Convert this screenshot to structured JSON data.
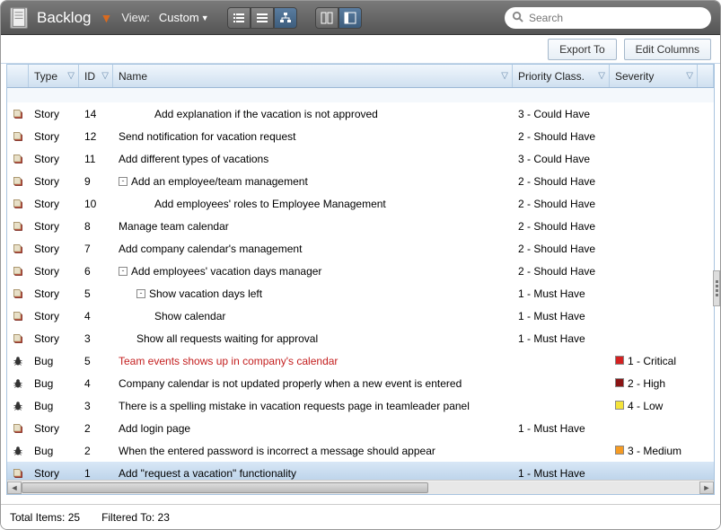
{
  "header": {
    "title": "Backlog",
    "view_label": "View:",
    "view_value": "Custom",
    "search_placeholder": "Search"
  },
  "toolbar": {
    "export_label": "Export To",
    "edit_columns_label": "Edit Columns"
  },
  "columns": {
    "type": "Type",
    "id": "ID",
    "name": "Name",
    "priority": "Priority Class.",
    "severity": "Severity"
  },
  "rows": [
    {
      "kind": "story",
      "type": "Story",
      "id": "14",
      "name": "Add explanation if the vacation is not approved",
      "indent": 2,
      "exp": "",
      "prio": "3 - Could Have",
      "sev": "",
      "sevColor": ""
    },
    {
      "kind": "story",
      "type": "Story",
      "id": "12",
      "name": "Send notification for vacation request",
      "indent": 0,
      "exp": "",
      "prio": "2 - Should Have",
      "sev": "",
      "sevColor": ""
    },
    {
      "kind": "story",
      "type": "Story",
      "id": "11",
      "name": "Add different types of vacations",
      "indent": 0,
      "exp": "",
      "prio": "3 - Could Have",
      "sev": "",
      "sevColor": ""
    },
    {
      "kind": "story",
      "type": "Story",
      "id": "9",
      "name": "Add an employee/team management",
      "indent": 0,
      "exp": "-",
      "prio": "2 - Should Have",
      "sev": "",
      "sevColor": ""
    },
    {
      "kind": "story",
      "type": "Story",
      "id": "10",
      "name": "Add employees' roles to Employee Management",
      "indent": 2,
      "exp": "",
      "prio": "2 - Should Have",
      "sev": "",
      "sevColor": ""
    },
    {
      "kind": "story",
      "type": "Story",
      "id": "8",
      "name": "Manage team calendar",
      "indent": 0,
      "exp": "",
      "prio": "2 - Should Have",
      "sev": "",
      "sevColor": ""
    },
    {
      "kind": "story",
      "type": "Story",
      "id": "7",
      "name": "Add company calendar's management",
      "indent": 0,
      "exp": "",
      "prio": "2 - Should Have",
      "sev": "",
      "sevColor": ""
    },
    {
      "kind": "story",
      "type": "Story",
      "id": "6",
      "name": "Add employees' vacation days manager",
      "indent": 0,
      "exp": "-",
      "prio": "2 - Should Have",
      "sev": "",
      "sevColor": ""
    },
    {
      "kind": "story",
      "type": "Story",
      "id": "5",
      "name": "Show vacation days left",
      "indent": 1,
      "exp": "-",
      "prio": "1 - Must Have",
      "sev": "",
      "sevColor": ""
    },
    {
      "kind": "story",
      "type": "Story",
      "id": "4",
      "name": "Show calendar",
      "indent": 2,
      "exp": "",
      "prio": "1 - Must Have",
      "sev": "",
      "sevColor": ""
    },
    {
      "kind": "story",
      "type": "Story",
      "id": "3",
      "name": "Show all requests waiting for approval",
      "indent": 1,
      "exp": "",
      "prio": "1 - Must Have",
      "sev": "",
      "sevColor": ""
    },
    {
      "kind": "bug",
      "type": "Bug",
      "id": "5",
      "name": "Team events shows up in company's calendar",
      "indent": 0,
      "exp": "",
      "prio": "",
      "sev": "1 - Critical",
      "sevColor": "#d32121",
      "red": true
    },
    {
      "kind": "bug",
      "type": "Bug",
      "id": "4",
      "name": "Company calendar is not updated properly when a new event is entered",
      "indent": 0,
      "exp": "",
      "prio": "",
      "sev": "2 - High",
      "sevColor": "#8a1414"
    },
    {
      "kind": "bug",
      "type": "Bug",
      "id": "3",
      "name": "There is a spelling mistake in vacation requests page in teamleader panel",
      "indent": 0,
      "exp": "",
      "prio": "",
      "sev": "4 - Low",
      "sevColor": "#f4e33a"
    },
    {
      "kind": "story",
      "type": "Story",
      "id": "2",
      "name": "Add login page",
      "indent": 0,
      "exp": "",
      "prio": "1 - Must Have",
      "sev": "",
      "sevColor": ""
    },
    {
      "kind": "bug",
      "type": "Bug",
      "id": "2",
      "name": "When the entered password is incorrect a message should appear",
      "indent": 0,
      "exp": "",
      "prio": "",
      "sev": "3 - Medium",
      "sevColor": "#f59b24"
    },
    {
      "kind": "story",
      "type": "Story",
      "id": "1",
      "name": "Add \"request a vacation\" functionality",
      "indent": 0,
      "exp": "",
      "prio": "1 - Must Have",
      "sev": "",
      "sevColor": "",
      "selected": true
    }
  ],
  "footer": {
    "total_label": "Total Items:",
    "total_value": "25",
    "filtered_label": "Filtered To:",
    "filtered_value": "23"
  }
}
